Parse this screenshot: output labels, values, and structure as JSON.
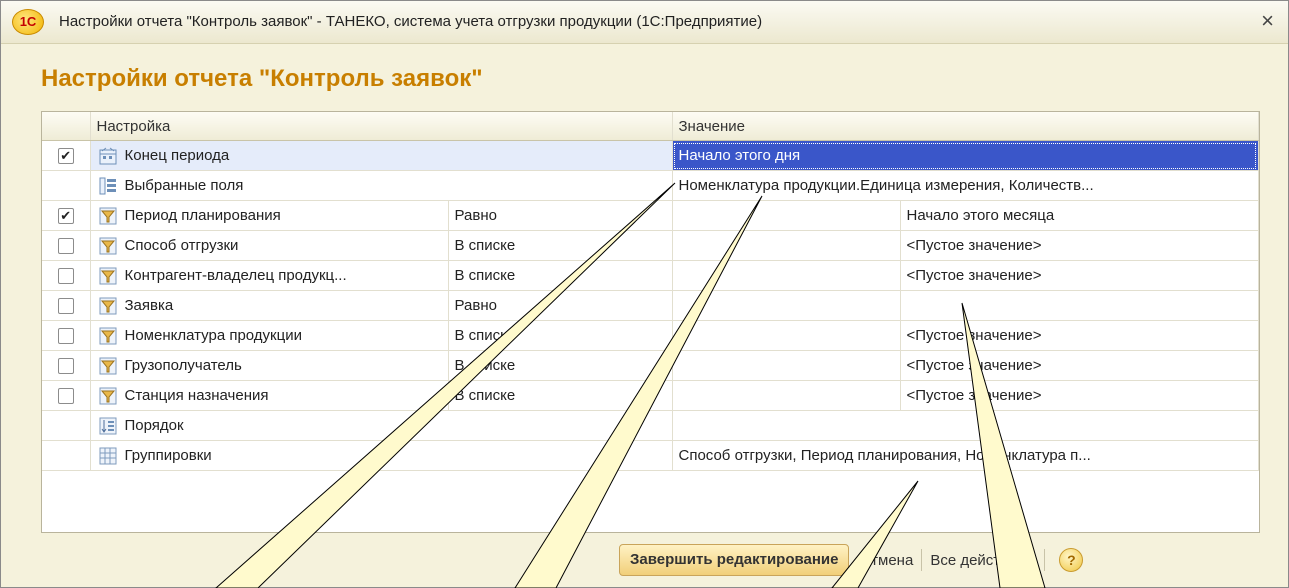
{
  "window": {
    "title": "Настройки отчета \"Контроль заявок\" - ТАНЕКО, система учета отгрузки продукции  (1С:Предприятие)",
    "logo": "1С",
    "close_glyph": "×"
  },
  "heading": "Настройки отчета \"Контроль заявок\"",
  "table": {
    "headers": {
      "setting": "Настройка",
      "value": "Значение"
    },
    "rows": [
      {
        "checked": true,
        "icon": "period-icon",
        "name": "Конец периода",
        "cond": "",
        "value": "Начало этого дня"
      },
      {
        "checked": null,
        "icon": "fields-icon",
        "name": "Выбранные поля",
        "cond": "",
        "value": "Номенклатура продукции.Единица измерения, Количеств..."
      },
      {
        "checked": true,
        "icon": "filter-icon",
        "name": "Период планирования",
        "cond": "Равно",
        "value": "Начало этого месяца"
      },
      {
        "checked": false,
        "icon": "filter-icon",
        "name": "Способ отгрузки",
        "cond": "В списке",
        "value": "<Пустое значение>"
      },
      {
        "checked": false,
        "icon": "filter-icon",
        "name": "Контрагент-владелец продукц...",
        "cond": "В списке",
        "value": "<Пустое значение>"
      },
      {
        "checked": false,
        "icon": "filter-icon",
        "name": "Заявка",
        "cond": "Равно",
        "value": ""
      },
      {
        "checked": false,
        "icon": "filter-icon",
        "name": "Номенклатура продукции",
        "cond": "В списке",
        "value": "<Пустое значение>"
      },
      {
        "checked": false,
        "icon": "filter-icon",
        "name": "Грузополучатель",
        "cond": "В списке",
        "value": "<Пустое значение>"
      },
      {
        "checked": false,
        "icon": "filter-icon",
        "name": "Станция назначения",
        "cond": "В списке",
        "value": "<Пустое значение>"
      },
      {
        "checked": null,
        "icon": "order-icon",
        "name": "Порядок",
        "cond": "",
        "value": ""
      },
      {
        "checked": null,
        "icon": "grouping-icon",
        "name": "Группировки",
        "cond": "",
        "value": "Способ отгрузки, Период планирования, Номенклатура п..."
      }
    ]
  },
  "footer": {
    "finish_label": "Завершить редактирование",
    "cancel_label": "Отмена",
    "all_actions_label": "Все действия ▾",
    "help_label": "?"
  },
  "colors": {
    "heading": "#c87f00",
    "selection": "#3a56c9",
    "callout_fill": "#fffacd"
  }
}
